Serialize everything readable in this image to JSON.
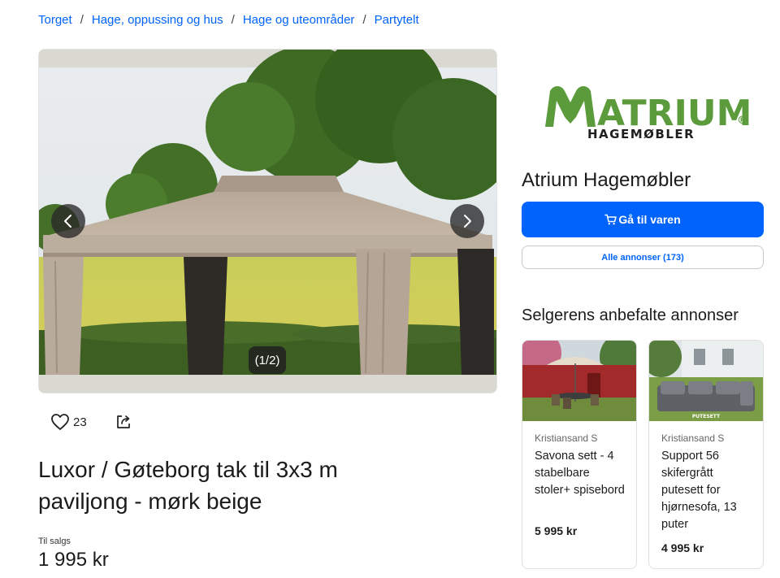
{
  "breadcrumb": [
    {
      "label": "Torget"
    },
    {
      "label": "Hage, oppussing og hus"
    },
    {
      "label": "Hage og uteområder"
    },
    {
      "label": "Partytelt"
    }
  ],
  "breadcrumb_separator": "/",
  "gallery": {
    "counter": "(1/2)",
    "prev_icon": "chevron-left-icon",
    "next_icon": "chevron-right-icon"
  },
  "actions": {
    "favorite_count": "23",
    "favorite_icon": "heart-icon",
    "share_icon": "share-icon"
  },
  "listing": {
    "title": "Luxor / Gøteborg tak til 3x3 m paviljong - mørk beige",
    "price_label": "Til salgs",
    "price": "1 995 kr"
  },
  "seller": {
    "logo_word": "ATRIUM",
    "logo_sub": "HAGEMØBLER",
    "logo_mark": "®",
    "name": "Atrium Hagemøbler",
    "go_button": "Gå til varen",
    "all_ads_button": "Alle annonser (173)",
    "cart_icon": "cart-icon"
  },
  "recommended": {
    "title": "Selgerens anbefalte annonser",
    "items": [
      {
        "location": "Kristiansand S",
        "title": "Savona sett - 4 stabelbare stoler+ spisebord",
        "price": "5 995 kr"
      },
      {
        "location": "Kristiansand S",
        "title": "Support 56 skifergrått putesett for hjørnesofa, 13 puter",
        "price": "4 995 kr",
        "image_label": "PUTESETT"
      }
    ]
  },
  "colors": {
    "accent": "#0063fb",
    "logo_green": "#5c9b3c",
    "text": "#1b1b1b"
  }
}
